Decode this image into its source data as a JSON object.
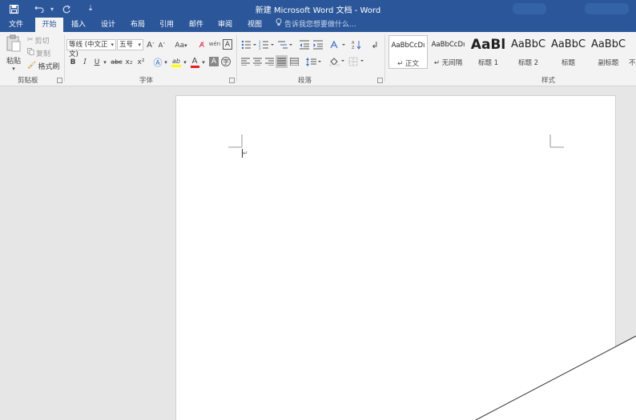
{
  "window": {
    "title": "新建 Microsoft Word 文档 - Word"
  },
  "quick_access": {
    "save_icon": "save-icon",
    "undo_icon": "undo-icon",
    "redo_icon": "redo-icon",
    "customize_icon": "customize-icon"
  },
  "tabs": [
    {
      "label": "文件"
    },
    {
      "label": "开始",
      "active": true
    },
    {
      "label": "插入"
    },
    {
      "label": "设计"
    },
    {
      "label": "布局"
    },
    {
      "label": "引用"
    },
    {
      "label": "邮件"
    },
    {
      "label": "审阅"
    },
    {
      "label": "视图"
    }
  ],
  "tell_me": {
    "placeholder": "告诉我您想要做什么..."
  },
  "clipboard": {
    "paste": "粘贴",
    "cut": "剪切",
    "copy": "复制",
    "format_painter": "格式刷",
    "label": "剪贴板"
  },
  "font": {
    "name": "等线 (中文正文)",
    "size": "五号",
    "grow": "A",
    "shrink": "A",
    "change_case": "Aa",
    "bold": "B",
    "italic": "I",
    "underline": "U",
    "strikethrough": "abc",
    "subscript": "x₂",
    "superscript": "x²",
    "highlight": "ab",
    "font_color": "A",
    "label": "字体",
    "highlight_color": "#ffff00",
    "font_color_value": "#e02020"
  },
  "paragraph": {
    "label": "段落"
  },
  "styles": {
    "label": "样式",
    "items": [
      {
        "sample": "AaBbCcDı",
        "name": "↵ 正文",
        "selected": true
      },
      {
        "sample": "AaBbCcDı",
        "name": "↵ 无间隔"
      },
      {
        "sample": "AaBl",
        "name": "标题 1"
      },
      {
        "sample": "AaBbC",
        "name": "标题 2"
      },
      {
        "sample": "AaBbC",
        "name": "标题"
      },
      {
        "sample": "AaBbC",
        "name": "副标题"
      },
      {
        "sample": "",
        "name": "不"
      }
    ]
  },
  "document": {
    "paragraph_mark": "↵"
  },
  "colors": {
    "title_bar": "#2b579a",
    "ribbon": "#f3f3f3",
    "workspace": "#e6e6e6",
    "page": "#ffffff"
  }
}
